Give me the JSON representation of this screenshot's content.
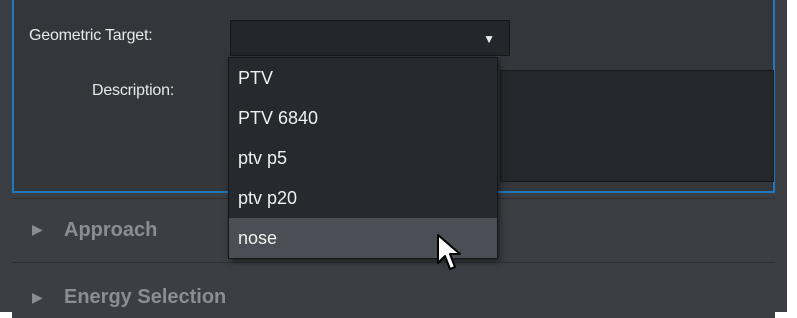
{
  "form": {
    "geometric_target_label": "Geometric Target:",
    "geometric_target_value": "",
    "description_label": "Description:",
    "description_value": ""
  },
  "dropdown": {
    "options": [
      "PTV",
      "PTV 6840",
      "ptv p5",
      "ptv p20",
      "nose"
    ],
    "highlighted": "nose"
  },
  "sections": [
    {
      "label": "Approach",
      "state": "collapsed"
    },
    {
      "label": "Energy Selection",
      "state": "collapsed"
    }
  ],
  "icons": {
    "caret": "caret-down-icon",
    "expand": "triangle-right-icon",
    "cursor": "mouse-pointer-icon"
  },
  "colors": {
    "accent": "#1e78c2",
    "panel": "#33373c",
    "highlight": "#4b4f55"
  }
}
